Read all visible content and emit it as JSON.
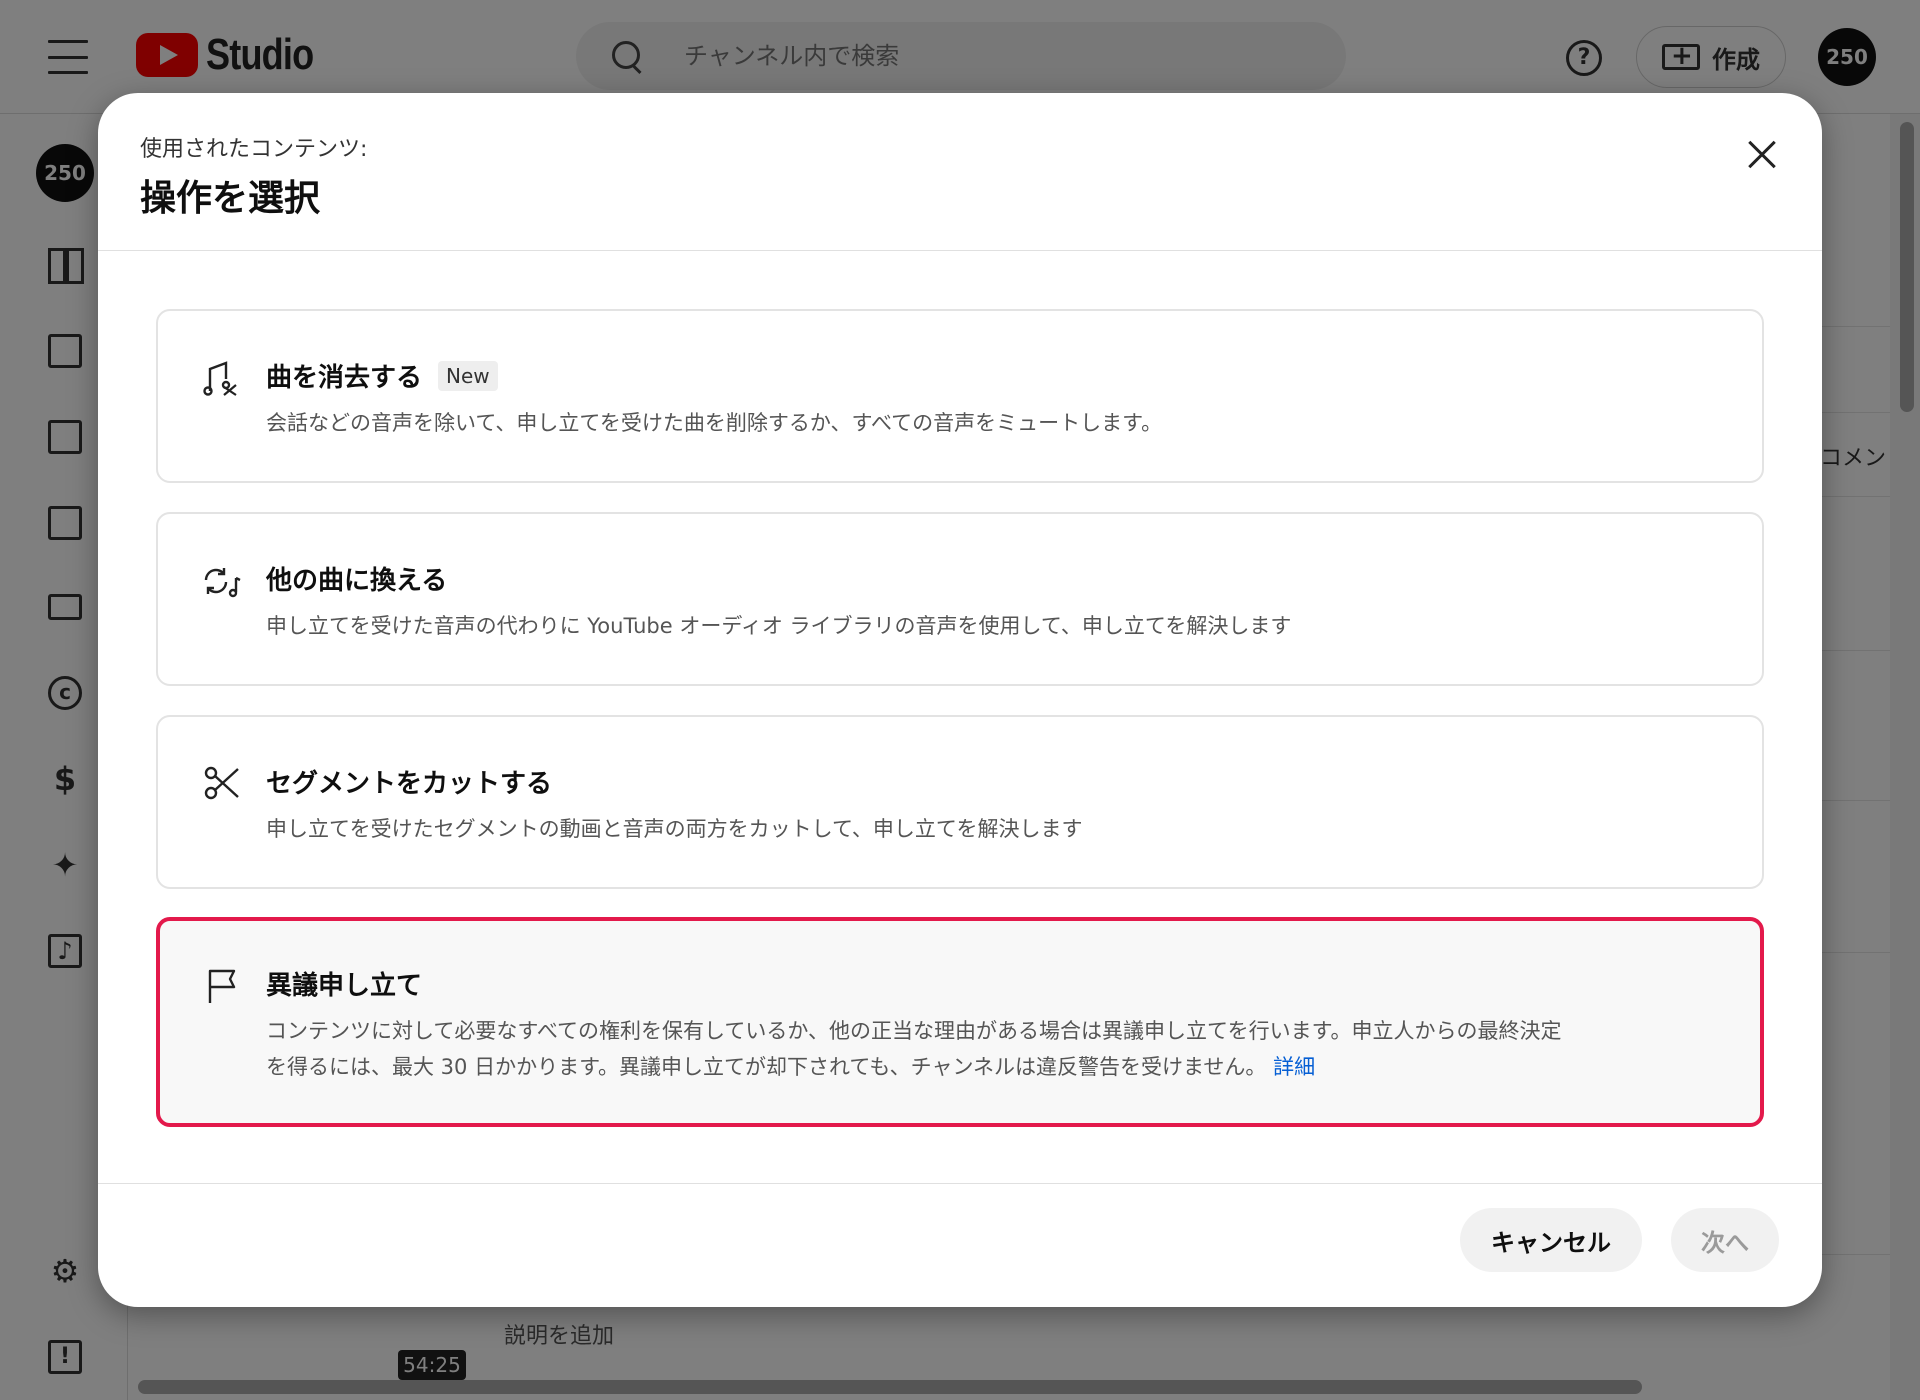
{
  "app": {
    "logo_text": "Studio",
    "search_placeholder": "チャンネル内で検索",
    "help_glyph": "?",
    "create_label": "作成",
    "avatar_text": "250"
  },
  "sidebar": {
    "avatar_text": "250",
    "items": [
      {
        "icon": "dashboard-icon"
      },
      {
        "icon": "content-icon"
      },
      {
        "icon": "analytics-icon"
      },
      {
        "icon": "comments-icon"
      },
      {
        "icon": "subtitles-icon"
      },
      {
        "icon": "copyright-icon",
        "glyph": "c"
      },
      {
        "icon": "earn-icon",
        "glyph": "$"
      },
      {
        "icon": "customization-icon",
        "glyph": "✦"
      },
      {
        "icon": "audio-library-icon",
        "glyph": "♪"
      },
      {
        "icon": "settings-icon",
        "glyph": "⚙"
      },
      {
        "icon": "feedback-icon",
        "glyph": "!"
      }
    ]
  },
  "background": {
    "comment_label": "コメン",
    "description_placeholder": "説明を追加",
    "duration": "54:25"
  },
  "modal": {
    "subtitle": "使用されたコンテンツ:",
    "title": "操作を選択",
    "options": [
      {
        "icon": "erase-song-icon",
        "title": "曲を消去する",
        "badge": "New",
        "description": "会話などの音声を除いて、申し立てを受けた曲を削除するか、すべての音声をミュートします。"
      },
      {
        "icon": "replace-song-icon",
        "title": "他の曲に換える",
        "description": "申し立てを受けた音声の代わりに YouTube オーディオ ライブラリの音声を使用して、申し立てを解決します"
      },
      {
        "icon": "scissors-icon",
        "title": "セグメントをカットする",
        "description": "申し立てを受けたセグメントの動画と音声の両方をカットして、申し立てを解決します"
      },
      {
        "icon": "flag-icon",
        "title": "異議申し立て",
        "description_line1": "コンテンツに対して必要なすべての権利を保有しているか、他の正当な理由がある場合は異議申し立てを行います。申立人からの最終決定",
        "description_line2": "を得るには、最大 30 日かかります。異議申し立てが却下されても、チャンネルは違反警告を受けません。",
        "link": "詳細",
        "selected": true
      }
    ],
    "cancel_label": "キャンセル",
    "next_label": "次へ"
  },
  "colors": {
    "selected_border": "#e3194b",
    "link": "#065fd4",
    "youtube_red": "#ff0000"
  }
}
